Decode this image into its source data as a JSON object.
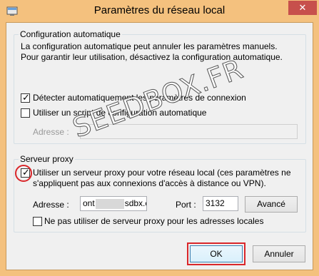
{
  "window": {
    "title": "Paramètres du réseau local",
    "close_label": "✕"
  },
  "auto_config": {
    "group_title": "Configuration automatique",
    "description": "La configuration automatique peut annuler les paramètres manuels. Pour garantir leur utilisation, désactivez la configuration automatique.",
    "detect_label": "Détecter automatiquement les paramètres de connexion",
    "detect_checked": true,
    "script_label": "Utiliser un script de configuration automatique",
    "script_checked": false,
    "address_label": "Adresse :",
    "address_value": ""
  },
  "proxy": {
    "group_title": "Serveur proxy",
    "use_proxy_label_line1": "Utiliser un serveur proxy pour votre réseau local (ces paramètres ne",
    "use_proxy_label_line2": "s'appliquent pas aux connexions d'accès à distance ou VPN).",
    "use_proxy_checked": true,
    "address_label": "Adresse :",
    "address_value_start": "ont",
    "address_value_end": "sdbx.co",
    "port_label": "Port :",
    "port_value": "3132",
    "advanced_label": "Avancé",
    "bypass_label": "Ne pas utiliser de serveur proxy pour les adresses locales",
    "bypass_checked": false
  },
  "footer": {
    "ok_label": "OK",
    "cancel_label": "Annuler"
  },
  "watermark": "SEEDBOX.FR",
  "colors": {
    "frame": "#f4c17e",
    "close": "#c7504c",
    "highlight": "#d9262a"
  }
}
